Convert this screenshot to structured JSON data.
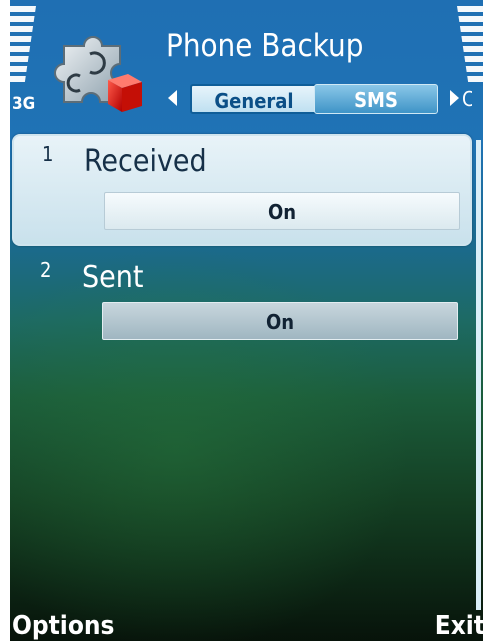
{
  "status": {
    "network": "3G",
    "top_fragment": "y"
  },
  "header": {
    "title": "Phone Backup",
    "tabs": [
      {
        "label": "General",
        "active": true
      },
      {
        "label": "SMS",
        "active": false
      }
    ],
    "next_tab_fragment": "C"
  },
  "list": {
    "items": [
      {
        "index": "1",
        "label": "Received",
        "value": "On",
        "selected": true
      },
      {
        "index": "2",
        "label": "Sent",
        "value": "On",
        "selected": false
      }
    ]
  },
  "softkeys": {
    "left": "Options",
    "right": "Exit"
  },
  "colors": {
    "accent": "#1f73b5",
    "tab_active_text": "#0b4f87",
    "background_bottom": "#07130a"
  },
  "icons": [
    "signal-icon",
    "battery-icon",
    "app-puzzle-icon",
    "arrow-left-icon",
    "arrow-right-icon"
  ]
}
